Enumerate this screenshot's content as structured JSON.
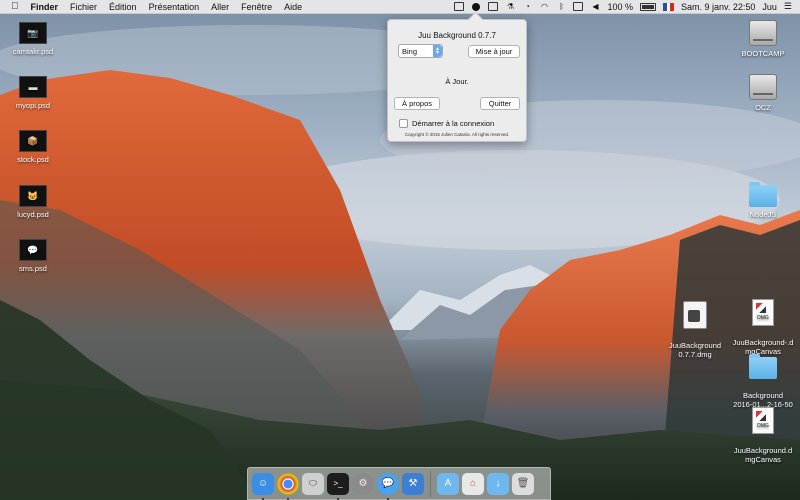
{
  "menubar": {
    "apple_icon": "apple-icon",
    "app_name": "Finder",
    "menus": [
      "Fichier",
      "Édition",
      "Présentation",
      "Aller",
      "Fenêtre",
      "Aide"
    ],
    "battery_percent": "100 %",
    "clock": "Sam. 9 janv.  22:50",
    "user": "Juu",
    "status_icons": [
      "screen-icon",
      "juu-background-icon",
      "app-icon",
      "wrench-icon",
      "timemachine-icon",
      "wifi-icon",
      "bluetooth-icon",
      "keyboard-icon",
      "volume-icon",
      "battery-icon",
      "flag-fr-icon"
    ]
  },
  "desktop_left": [
    {
      "label": "camtakr.psd",
      "glyph": "📷"
    },
    {
      "label": "myopi.psd",
      "glyph": "▬"
    },
    {
      "label": "stock.psd",
      "glyph": "📦"
    },
    {
      "label": "lucyd.psd",
      "glyph": "🐱"
    },
    {
      "label": "sms.psd",
      "glyph": "💬"
    }
  ],
  "desktop_right": {
    "bootcamp": "BOOTCAMP",
    "ocz": "OCZ",
    "nodejs": "NodeJS",
    "dmg1": "JuuBackground\n0.7.7.dmg",
    "dmgcanvas1": "JuuBackground-.d\nmgCanvas",
    "folder2": "Background\n2016-01...2-16-50",
    "dmgcanvas2": "JuuBackground.d\nmgCanvas",
    "dmg_label": "DMG"
  },
  "popover": {
    "title": "Juu Background 0.7.7",
    "source_selected": "Bing",
    "update_button": "Mise à jour",
    "status": "À Jour.",
    "about_button": "À propos",
    "quit_button": "Quitter",
    "login_checkbox_label": "Démarrer à la connexion",
    "login_checked": false,
    "copyright": "Copyright © 2015 Julien Catania. All rights reserved."
  },
  "dock": [
    {
      "name": "finder",
      "glyph": "☺",
      "color": "#3a8ee6",
      "running": true
    },
    {
      "name": "chrome",
      "glyph": "◉",
      "color": "#ffffff",
      "running": true
    },
    {
      "name": "disk-utility",
      "glyph": "⬭",
      "color": "#cfcfcf",
      "running": false
    },
    {
      "name": "terminal",
      "glyph": ">_",
      "color": "#1d1d1d",
      "running": true
    },
    {
      "name": "system-preferences",
      "glyph": "⚙",
      "color": "#8a8a8a",
      "running": false
    },
    {
      "name": "messages",
      "glyph": "💬",
      "color": "#4aa3f0",
      "running": true
    },
    {
      "name": "xcode",
      "glyph": "⚒",
      "color": "#3c7fd4",
      "running": false
    },
    {
      "name": "applications-folder",
      "glyph": "A",
      "color": "#6fb8ef",
      "running": false
    },
    {
      "name": "home-folder",
      "glyph": "⌂",
      "color": "#e8e8e8",
      "running": false
    },
    {
      "name": "downloads-folder",
      "glyph": "↓",
      "color": "#6fb8ef",
      "running": false
    },
    {
      "name": "trash",
      "glyph": "🗑",
      "color": "#dcdcdc",
      "running": false
    }
  ]
}
